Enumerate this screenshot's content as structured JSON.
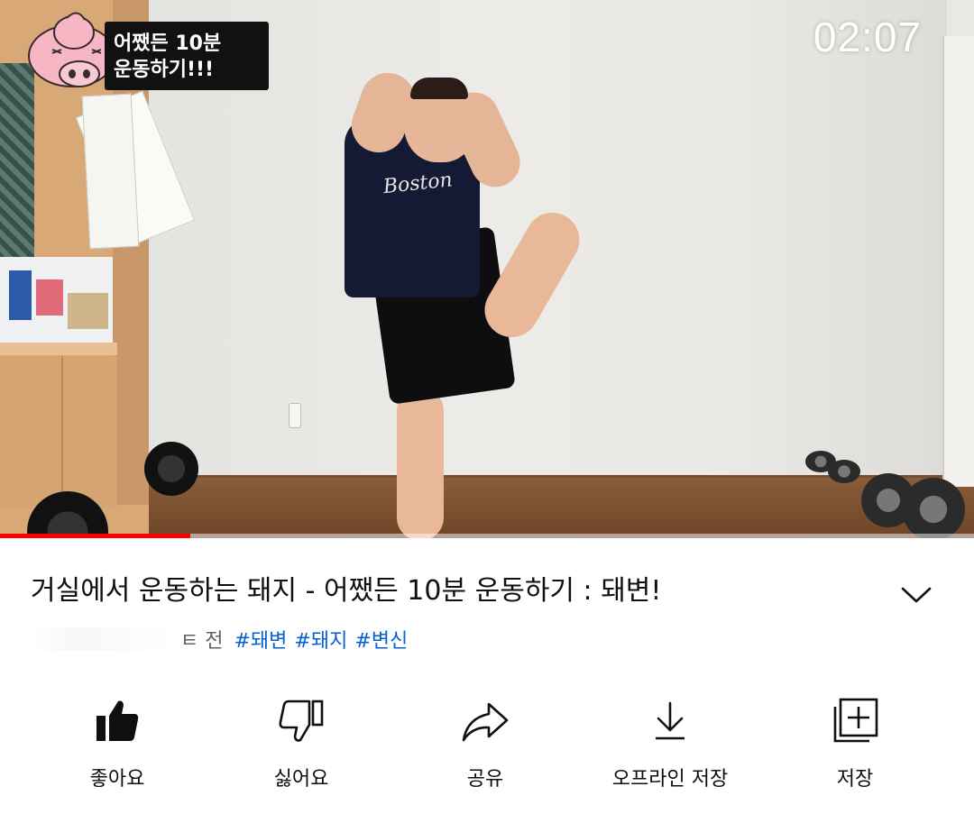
{
  "player": {
    "timer": "02:07",
    "overlay_title_line1": "어쨌든 10분",
    "overlay_title_line2": "운동하기!!!",
    "shirt_logo": "Boston",
    "progress": 0.195,
    "progress_color": "#ff0000"
  },
  "video": {
    "title": "거실에서 운동하는 돼지 - 어쨌든 10분 운동하기 : 돼변!",
    "time_ago_partial": "ㅌ 전",
    "hashtags": [
      "#돼변",
      "#돼지",
      "#변신"
    ]
  },
  "actions": [
    {
      "label": "좋아요",
      "icon": "thumbs-up-filled-icon"
    },
    {
      "label": "싫어요",
      "icon": "thumbs-down-icon"
    },
    {
      "label": "공유",
      "icon": "share-icon"
    },
    {
      "label": "오프라인 저장",
      "icon": "download-icon"
    },
    {
      "label": "저장",
      "icon": "add-to-playlist-icon"
    }
  ],
  "colors": {
    "hashtag": "#065fd4",
    "text_primary": "#0f0f0f",
    "text_secondary": "#606060"
  }
}
